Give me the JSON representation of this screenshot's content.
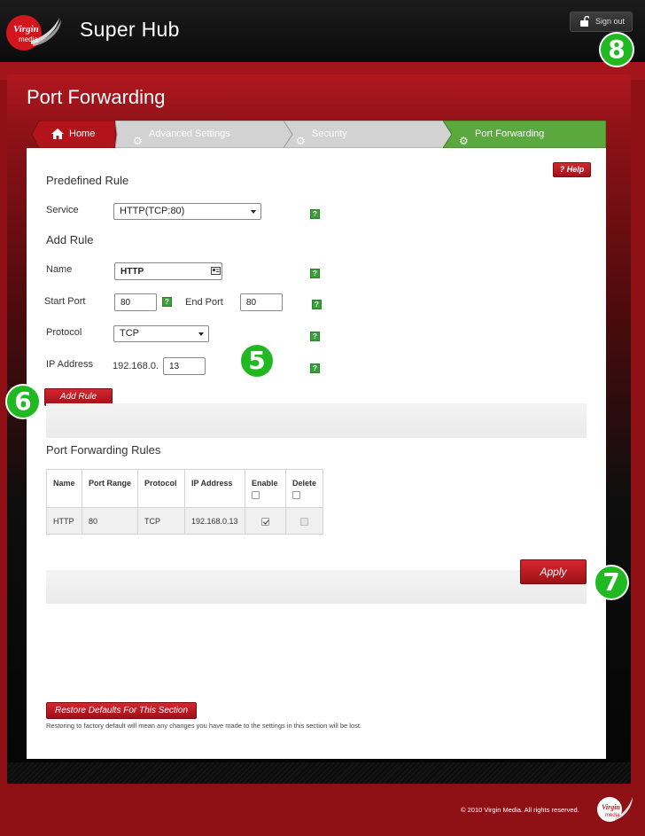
{
  "header": {
    "brand_line1": "Virgin",
    "brand_line2": "media",
    "app_title": "Super Hub",
    "signout_label": "Sign out"
  },
  "page": {
    "title": "Port Forwarding",
    "breadcrumbs": [
      {
        "label": "Home",
        "icon": "home-icon"
      },
      {
        "label": "Advanced Settings",
        "icon": "gear-icon"
      },
      {
        "label": "Security",
        "icon": "gear-icon"
      },
      {
        "label": "Port Forwarding",
        "icon": "gear-icon"
      }
    ],
    "help_label": "? Help"
  },
  "predefined": {
    "title": "Predefined Rule",
    "service_label": "Service",
    "service_value": "HTTP(TCP:80)"
  },
  "add_rule": {
    "title": "Add Rule",
    "name_label": "Name",
    "name_value": "HTTP",
    "start_port_label": "Start Port",
    "start_port_value": "80",
    "end_port_label": "End Port",
    "end_port_value": "80",
    "protocol_label": "Protocol",
    "protocol_value": "TCP",
    "ip_label": "IP Address",
    "ip_prefix": "192.168.0.",
    "ip_suffix_value": "13",
    "add_button": "Add Rule"
  },
  "rules_table": {
    "title": "Port Forwarding Rules",
    "headers": [
      "Name",
      "Port Range",
      "Protocol",
      "IP Address",
      "Enable",
      "Delete"
    ],
    "rows": [
      {
        "name": "HTTP",
        "port_range": "80",
        "protocol": "TCP",
        "ip": "192.168.0.13",
        "enable": true,
        "delete": false
      }
    ]
  },
  "actions": {
    "apply": "Apply",
    "restore": "Restore Defaults For This Section",
    "restore_note": "Restoring to factory default will mean any changes you have made to the settings in this section will be lost."
  },
  "markers": [
    "5",
    "6",
    "7",
    "8"
  ],
  "footer": {
    "copyright": "© 2010 Virgin Media. All rights reserved."
  },
  "colors": {
    "brand_red": "#c5171f",
    "active_green": "#5aa83e",
    "help_green": "#3aa13a",
    "marker_green": "#21b921"
  }
}
